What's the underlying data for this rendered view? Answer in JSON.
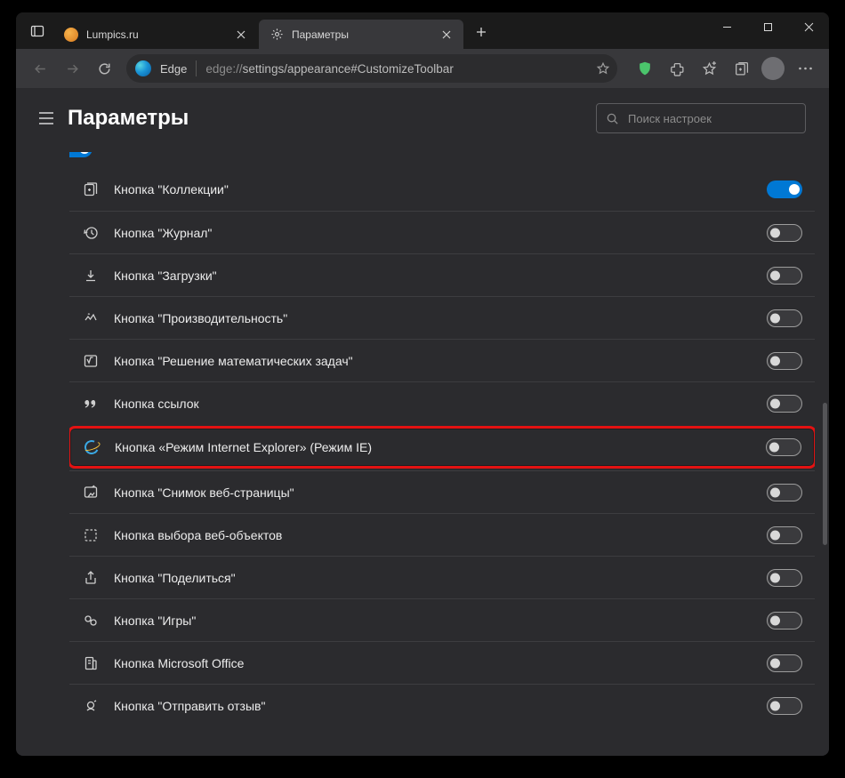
{
  "tabs": [
    {
      "title": "Lumpics.ru",
      "active": false
    },
    {
      "title": "Параметры",
      "active": true
    }
  ],
  "addressbar": {
    "edge_label": "Edge",
    "url_prefix": "edge://",
    "url_rest": "settings/appearance#CustomizeToolbar"
  },
  "settings": {
    "title": "Параметры",
    "search_placeholder": "Поиск настроек",
    "rows": [
      {
        "label": "Кнопка \"Коллекции\"",
        "on": true,
        "icon": "collections"
      },
      {
        "label": "Кнопка \"Журнал\"",
        "on": false,
        "icon": "history"
      },
      {
        "label": "Кнопка \"Загрузки\"",
        "on": false,
        "icon": "download"
      },
      {
        "label": "Кнопка \"Производительность\"",
        "on": false,
        "icon": "performance"
      },
      {
        "label": "Кнопка \"Решение математических задач\"",
        "on": false,
        "icon": "math"
      },
      {
        "label": "Кнопка ссылок",
        "on": false,
        "icon": "citations"
      },
      {
        "label": "Кнопка «Режим Internet Explorer» (Режим IE)",
        "on": false,
        "icon": "ie",
        "highlight": true
      },
      {
        "label": "Кнопка \"Снимок веб-страницы\"",
        "on": false,
        "icon": "snapshot"
      },
      {
        "label": "Кнопка выбора веб-объектов",
        "on": false,
        "icon": "web-select"
      },
      {
        "label": "Кнопка \"Поделиться\"",
        "on": false,
        "icon": "share"
      },
      {
        "label": "Кнопка \"Игры\"",
        "on": false,
        "icon": "games"
      },
      {
        "label": "Кнопка Microsoft Office",
        "on": false,
        "icon": "office"
      },
      {
        "label": "Кнопка \"Отправить отзыв\"",
        "on": false,
        "icon": "feedback"
      }
    ]
  }
}
